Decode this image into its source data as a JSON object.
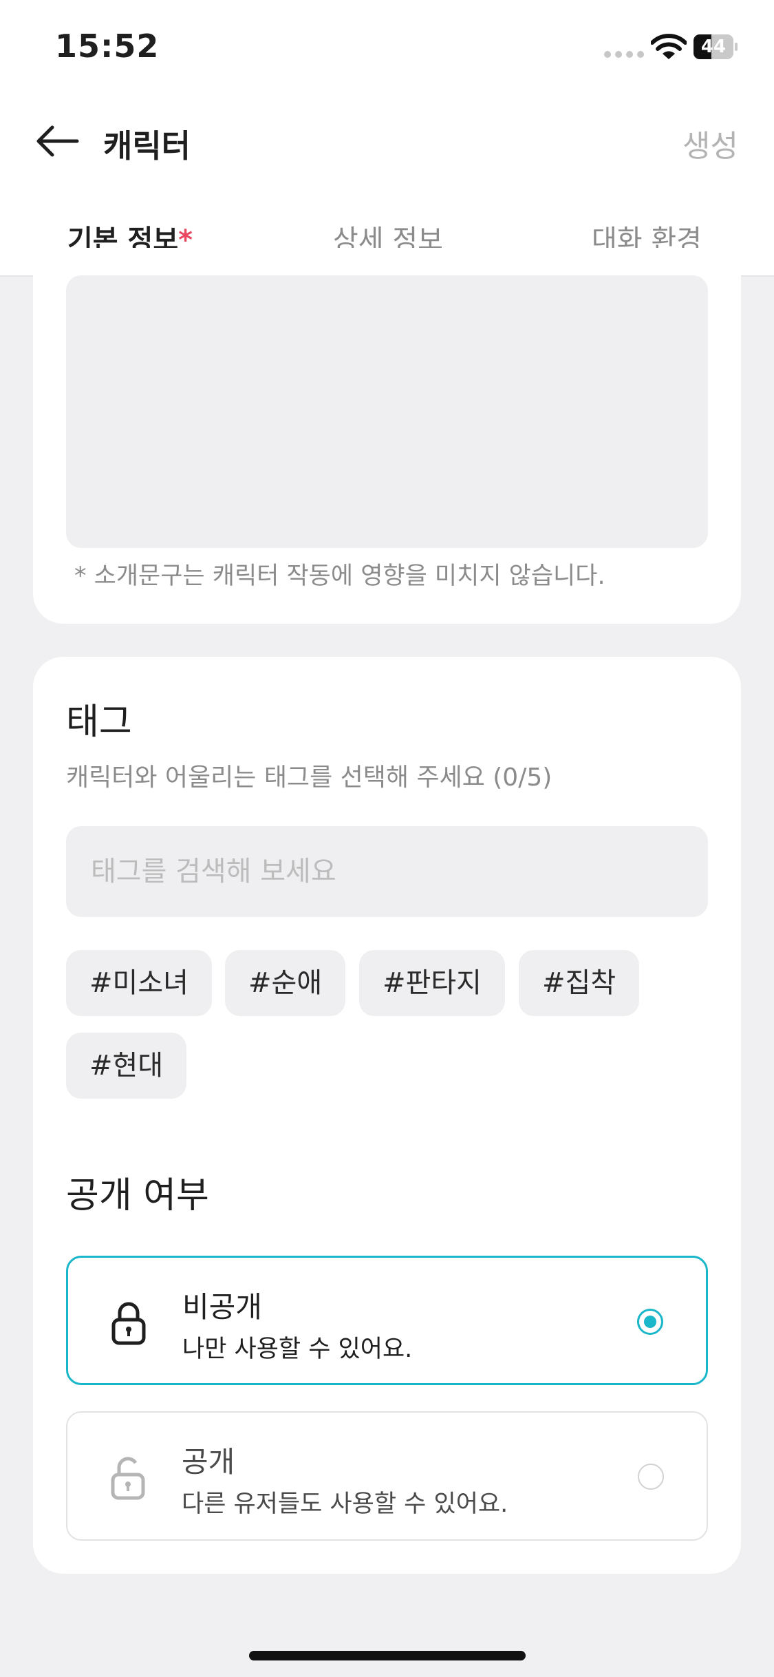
{
  "status_bar": {
    "time": "15:52",
    "battery": "44",
    "battery_level": 0.44
  },
  "header": {
    "title": "캐릭터",
    "create_label": "생성"
  },
  "tabs": [
    {
      "label": "기본 정보",
      "required_mark": "*",
      "active": true
    },
    {
      "label": "상세 정보",
      "active": false
    },
    {
      "label": "대화 환경",
      "active": false
    }
  ],
  "intro": {
    "note": "* 소개문구는 캐릭터 작동에 영향을 미치지 않습니다."
  },
  "tags": {
    "title": "태그",
    "subtitle": "캐릭터와 어울리는 태그를 선택해 주세요 (0/5)",
    "search_placeholder": "태그를 검색해 보세요",
    "items": [
      "#미소녀",
      "#순애",
      "#판타지",
      "#집착",
      "#현대"
    ]
  },
  "visibility": {
    "title": "공개 여부",
    "options": [
      {
        "label": "비공개",
        "desc": "나만 사용할 수 있어요.",
        "icon": "lock-icon",
        "selected": true
      },
      {
        "label": "공개",
        "desc": "다른 유저들도 사용할 수 있어요.",
        "icon": "unlock-icon",
        "selected": false
      }
    ]
  },
  "colors": {
    "accent": "#19b7c9",
    "required": "#e8475f"
  }
}
